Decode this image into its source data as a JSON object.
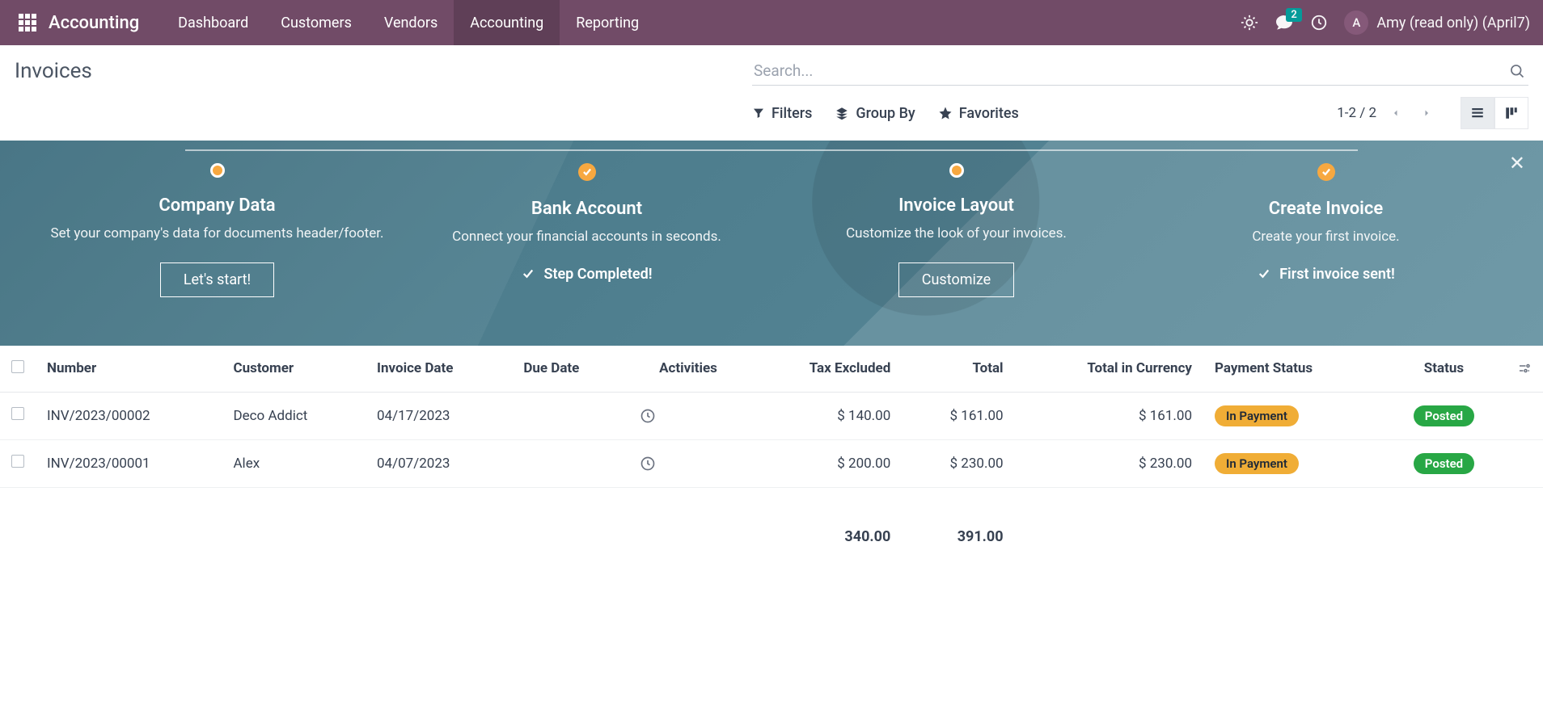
{
  "app_title": "Accounting",
  "nav": {
    "items": [
      "Dashboard",
      "Customers",
      "Vendors",
      "Accounting",
      "Reporting"
    ],
    "active_index": 3
  },
  "top_right": {
    "msg_badge": "2",
    "user_initial": "A",
    "user_name": "Amy (read only) (April7)"
  },
  "breadcrumb": "Invoices",
  "search": {
    "placeholder": "Search..."
  },
  "tools": {
    "filters": "Filters",
    "groupby": "Group By",
    "favorites": "Favorites"
  },
  "pager": {
    "range": "1-2 / 2"
  },
  "onboarding": {
    "steps": [
      {
        "title": "Company Data",
        "desc": "Set your company's data for documents header/footer.",
        "action": "Let's start!",
        "done": false
      },
      {
        "title": "Bank Account",
        "desc": "Connect your financial accounts in seconds.",
        "done_label": "Step Completed!",
        "done": true
      },
      {
        "title": "Invoice Layout",
        "desc": "Customize the look of your invoices.",
        "action": "Customize",
        "done": false
      },
      {
        "title": "Create Invoice",
        "desc": "Create your first invoice.",
        "done_label": "First invoice sent!",
        "done": true
      }
    ]
  },
  "table": {
    "columns": [
      "Number",
      "Customer",
      "Invoice Date",
      "Due Date",
      "Activities",
      "Tax Excluded",
      "Total",
      "Total in Currency",
      "Payment Status",
      "Status"
    ],
    "rows": [
      {
        "number": "INV/2023/00002",
        "customer": "Deco Addict",
        "invoice_date": "04/17/2023",
        "due_date": "",
        "tax_excluded": "$ 140.00",
        "total": "$ 161.00",
        "total_currency": "$ 161.00",
        "payment_status": "In Payment",
        "status": "Posted"
      },
      {
        "number": "INV/2023/00001",
        "customer": "Alex",
        "invoice_date": "04/07/2023",
        "due_date": "",
        "tax_excluded": "$ 200.00",
        "total": "$ 230.00",
        "total_currency": "$ 230.00",
        "payment_status": "In Payment",
        "status": "Posted"
      }
    ],
    "totals": {
      "tax_excluded": "340.00",
      "total": "391.00"
    }
  }
}
